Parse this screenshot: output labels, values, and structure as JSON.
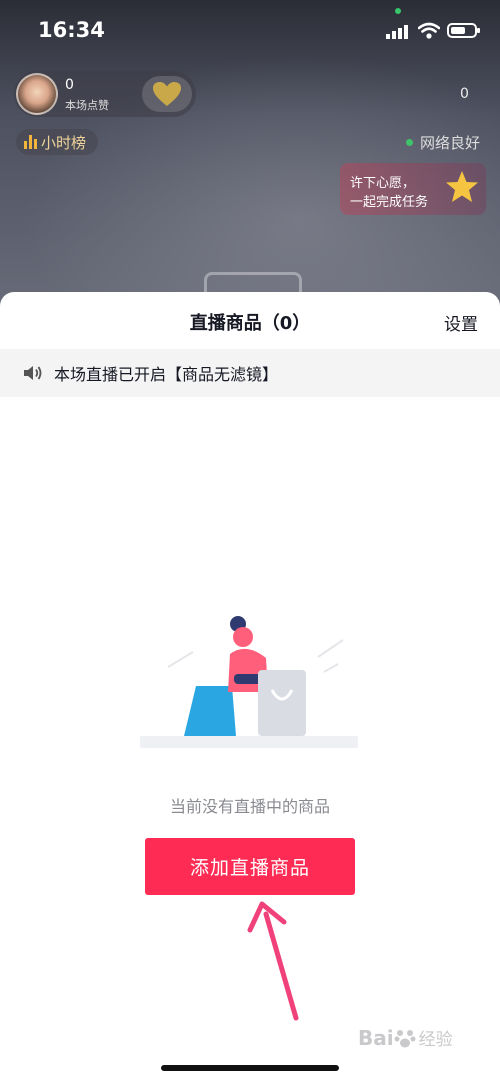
{
  "status_bar": {
    "time": "16:34"
  },
  "host": {
    "likes": "0",
    "likes_label": "本场点赞"
  },
  "viewers": "0",
  "rank": {
    "label": "小时榜"
  },
  "network": {
    "label": "网络良好",
    "color": "#3ec36b"
  },
  "wish": {
    "line1": "许下心愿，",
    "line2": "一起完成任务"
  },
  "sheet": {
    "title": "直播商品（0）",
    "settings_label": "设置",
    "notice": "本场直播已开启【商品无滤镜】",
    "empty_message": "当前没有直播中的商品",
    "add_button_label": "添加直播商品"
  },
  "watermark": {
    "logo": "Bai",
    "text": "经验"
  },
  "colors": {
    "accent": "#fe2c55",
    "arrow": "#f0417a"
  }
}
